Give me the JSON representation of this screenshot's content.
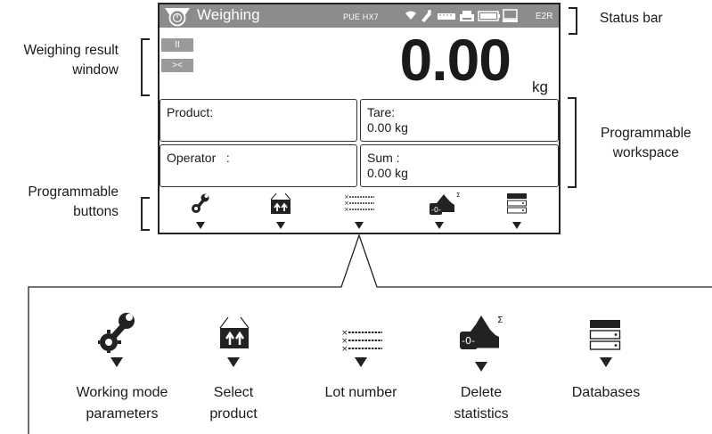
{
  "screen": {
    "title": "Weighing",
    "model": "PUE HX7",
    "code": "E2R",
    "btn_pause": "II",
    "btn_zero": "><",
    "reading": "0.00",
    "unit": "kg",
    "fields": [
      {
        "label": "Product:",
        "value": ""
      },
      {
        "label": "Tare:",
        "value": "0.00 kg"
      },
      {
        "label": "Operator   :",
        "value": ""
      },
      {
        "label": "Sum :",
        "value": "0.00 kg"
      }
    ]
  },
  "callouts": {
    "status_bar": "Status bar",
    "weighing_line1": "Weighing result",
    "weighing_line2": "window",
    "workspace_line1": "Programmable",
    "workspace_line2": "workspace",
    "buttons_line1": "Programmable",
    "buttons_line2": "buttons"
  },
  "detail_buttons": [
    {
      "icon": "wrench-gear-icon",
      "line1": "Working mode",
      "line2": "parameters"
    },
    {
      "icon": "box-arrows-icon",
      "line1": "Select",
      "line2": "product"
    },
    {
      "icon": "lot-list-icon",
      "line1": "Lot number",
      "line2": ""
    },
    {
      "icon": "histogram-zero-icon",
      "line1": "Delete",
      "line2": "statistics"
    },
    {
      "icon": "database-icon",
      "line1": "Databases",
      "line2": ""
    }
  ]
}
